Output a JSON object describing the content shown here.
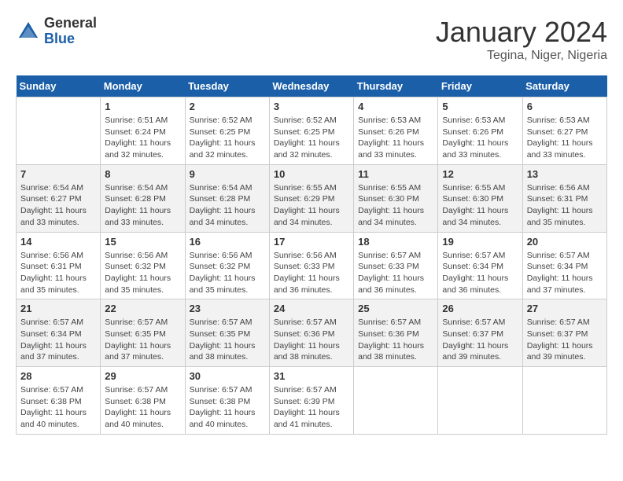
{
  "header": {
    "logo_general": "General",
    "logo_blue": "Blue",
    "month_title": "January 2024",
    "location": "Tegina, Niger, Nigeria"
  },
  "days_of_week": [
    "Sunday",
    "Monday",
    "Tuesday",
    "Wednesday",
    "Thursday",
    "Friday",
    "Saturday"
  ],
  "weeks": [
    [
      {
        "day": "",
        "info": ""
      },
      {
        "day": "1",
        "info": "Sunrise: 6:51 AM\nSunset: 6:24 PM\nDaylight: 11 hours and 32 minutes."
      },
      {
        "day": "2",
        "info": "Sunrise: 6:52 AM\nSunset: 6:25 PM\nDaylight: 11 hours and 32 minutes."
      },
      {
        "day": "3",
        "info": "Sunrise: 6:52 AM\nSunset: 6:25 PM\nDaylight: 11 hours and 32 minutes."
      },
      {
        "day": "4",
        "info": "Sunrise: 6:53 AM\nSunset: 6:26 PM\nDaylight: 11 hours and 33 minutes."
      },
      {
        "day": "5",
        "info": "Sunrise: 6:53 AM\nSunset: 6:26 PM\nDaylight: 11 hours and 33 minutes."
      },
      {
        "day": "6",
        "info": "Sunrise: 6:53 AM\nSunset: 6:27 PM\nDaylight: 11 hours and 33 minutes."
      }
    ],
    [
      {
        "day": "7",
        "info": "Sunrise: 6:54 AM\nSunset: 6:27 PM\nDaylight: 11 hours and 33 minutes."
      },
      {
        "day": "8",
        "info": "Sunrise: 6:54 AM\nSunset: 6:28 PM\nDaylight: 11 hours and 33 minutes."
      },
      {
        "day": "9",
        "info": "Sunrise: 6:54 AM\nSunset: 6:28 PM\nDaylight: 11 hours and 34 minutes."
      },
      {
        "day": "10",
        "info": "Sunrise: 6:55 AM\nSunset: 6:29 PM\nDaylight: 11 hours and 34 minutes."
      },
      {
        "day": "11",
        "info": "Sunrise: 6:55 AM\nSunset: 6:30 PM\nDaylight: 11 hours and 34 minutes."
      },
      {
        "day": "12",
        "info": "Sunrise: 6:55 AM\nSunset: 6:30 PM\nDaylight: 11 hours and 34 minutes."
      },
      {
        "day": "13",
        "info": "Sunrise: 6:56 AM\nSunset: 6:31 PM\nDaylight: 11 hours and 35 minutes."
      }
    ],
    [
      {
        "day": "14",
        "info": "Sunrise: 6:56 AM\nSunset: 6:31 PM\nDaylight: 11 hours and 35 minutes."
      },
      {
        "day": "15",
        "info": "Sunrise: 6:56 AM\nSunset: 6:32 PM\nDaylight: 11 hours and 35 minutes."
      },
      {
        "day": "16",
        "info": "Sunrise: 6:56 AM\nSunset: 6:32 PM\nDaylight: 11 hours and 35 minutes."
      },
      {
        "day": "17",
        "info": "Sunrise: 6:56 AM\nSunset: 6:33 PM\nDaylight: 11 hours and 36 minutes."
      },
      {
        "day": "18",
        "info": "Sunrise: 6:57 AM\nSunset: 6:33 PM\nDaylight: 11 hours and 36 minutes."
      },
      {
        "day": "19",
        "info": "Sunrise: 6:57 AM\nSunset: 6:34 PM\nDaylight: 11 hours and 36 minutes."
      },
      {
        "day": "20",
        "info": "Sunrise: 6:57 AM\nSunset: 6:34 PM\nDaylight: 11 hours and 37 minutes."
      }
    ],
    [
      {
        "day": "21",
        "info": "Sunrise: 6:57 AM\nSunset: 6:34 PM\nDaylight: 11 hours and 37 minutes."
      },
      {
        "day": "22",
        "info": "Sunrise: 6:57 AM\nSunset: 6:35 PM\nDaylight: 11 hours and 37 minutes."
      },
      {
        "day": "23",
        "info": "Sunrise: 6:57 AM\nSunset: 6:35 PM\nDaylight: 11 hours and 38 minutes."
      },
      {
        "day": "24",
        "info": "Sunrise: 6:57 AM\nSunset: 6:36 PM\nDaylight: 11 hours and 38 minutes."
      },
      {
        "day": "25",
        "info": "Sunrise: 6:57 AM\nSunset: 6:36 PM\nDaylight: 11 hours and 38 minutes."
      },
      {
        "day": "26",
        "info": "Sunrise: 6:57 AM\nSunset: 6:37 PM\nDaylight: 11 hours and 39 minutes."
      },
      {
        "day": "27",
        "info": "Sunrise: 6:57 AM\nSunset: 6:37 PM\nDaylight: 11 hours and 39 minutes."
      }
    ],
    [
      {
        "day": "28",
        "info": "Sunrise: 6:57 AM\nSunset: 6:38 PM\nDaylight: 11 hours and 40 minutes."
      },
      {
        "day": "29",
        "info": "Sunrise: 6:57 AM\nSunset: 6:38 PM\nDaylight: 11 hours and 40 minutes."
      },
      {
        "day": "30",
        "info": "Sunrise: 6:57 AM\nSunset: 6:38 PM\nDaylight: 11 hours and 40 minutes."
      },
      {
        "day": "31",
        "info": "Sunrise: 6:57 AM\nSunset: 6:39 PM\nDaylight: 11 hours and 41 minutes."
      },
      {
        "day": "",
        "info": ""
      },
      {
        "day": "",
        "info": ""
      },
      {
        "day": "",
        "info": ""
      }
    ]
  ]
}
